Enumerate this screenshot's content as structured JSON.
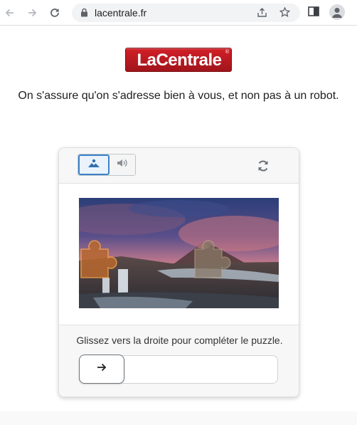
{
  "browser": {
    "url": "lacentrale.fr",
    "icons": {
      "back": "arrow-left-icon",
      "forward": "arrow-right-icon",
      "reload": "reload-icon",
      "lock": "lock-icon",
      "share": "share-icon",
      "bookmark": "star-icon",
      "side_panel": "side-panel-icon",
      "profile": "profile-icon"
    }
  },
  "logo": {
    "text": "LaCentrale",
    "reg": "®",
    "color": "#c0161e"
  },
  "page": {
    "heading": "On s'assure qu'on s'adresse bien à vous, et non pas à un robot."
  },
  "captcha": {
    "modes": [
      "image-icon",
      "audio-icon"
    ],
    "active_mode": "image",
    "refresh_icon": "refresh-icon",
    "instruction": "Glissez vers la droite pour compléter le puzzle.",
    "slider_icon": "arrow-right-icon",
    "slider_progress": 0,
    "accent_color": "#3c82c9"
  }
}
